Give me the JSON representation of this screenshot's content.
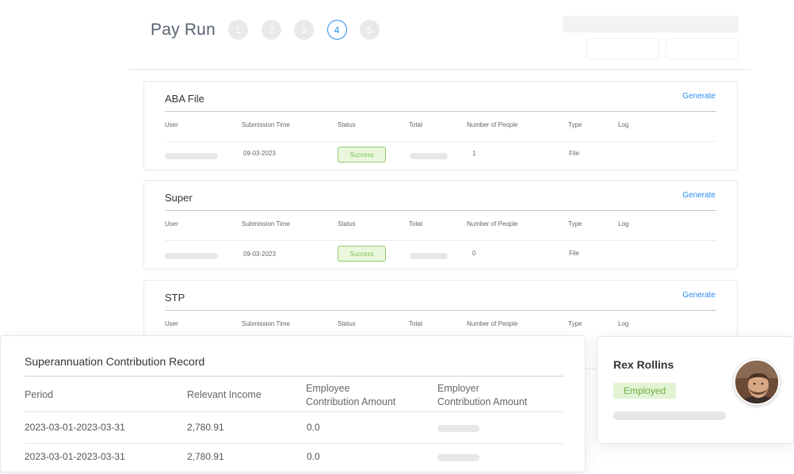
{
  "header": {
    "title": "Pay Run",
    "steps": [
      "1",
      "2",
      "3",
      "4",
      "5"
    ],
    "active_step": "4"
  },
  "sections": [
    {
      "title": "ABA File",
      "action": "Generate",
      "columns": [
        "User",
        "Submission Time",
        "Status",
        "Total",
        "Number of People",
        "Type",
        "Log"
      ],
      "row": {
        "submission_time": "09-03-2023",
        "status": "Success",
        "people": "1",
        "type": "File"
      }
    },
    {
      "title": "Super",
      "action": "Generate",
      "columns": [
        "User",
        "Submission Time",
        "Status",
        "Total",
        "Number of People",
        "Type",
        "Log"
      ],
      "row": {
        "submission_time": "09-03-2023",
        "status": "Success",
        "people": "0",
        "type": "File"
      }
    },
    {
      "title": "STP",
      "action": "Generate",
      "columns": [
        "User",
        "Submission Time",
        "Status",
        "Total",
        "Number of People",
        "Type",
        "Log"
      ]
    }
  ],
  "record": {
    "title": "Superannuation Contribution Record",
    "columns": {
      "period": "Period",
      "income": "Relevant Income",
      "employee_1": "Employee",
      "employee_2": "Contribution Amount",
      "employer_1": "Employer",
      "employer_2": "Contribution Amount"
    },
    "rows": [
      {
        "period": "2023-03-01-2023-03-31",
        "income": "2,780.91",
        "employee_amount": "0.0"
      },
      {
        "period": "2023-03-01-2023-03-31",
        "income": "2,780.91",
        "employee_amount": "0.0"
      }
    ]
  },
  "profile": {
    "name": "Rex Rollins",
    "status": "Employed"
  },
  "colors": {
    "accent": "#2a8cf0",
    "success_bg": "#eaf7dd",
    "success_text": "#7fbf55",
    "placeholder": "#e7e7e7"
  }
}
